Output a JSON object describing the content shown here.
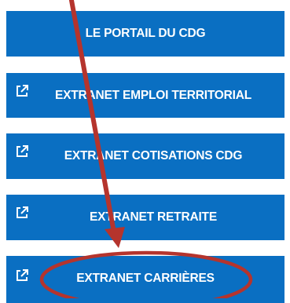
{
  "menu": {
    "items": [
      {
        "label": "LE PORTAIL DU CDG",
        "external": false
      },
      {
        "label": "EXTRANET EMPLOI TERRITORIAL",
        "external": true
      },
      {
        "label": "EXTRANET COTISATIONS CDG",
        "external": true
      },
      {
        "label": "EXTRANET RETRAITE",
        "external": true
      },
      {
        "label": "EXTRANET CARRIÈRES",
        "external": true
      }
    ],
    "icon": "external-link-icon"
  },
  "colors": {
    "button_bg": "#0a6fc2",
    "button_text": "#ffffff",
    "annotation": "#b5342d"
  },
  "annotation": {
    "arrow_icon": "arrow-annotation",
    "circle_icon": "circle-annotation",
    "target": "EXTRANET CARRIÈRES"
  }
}
